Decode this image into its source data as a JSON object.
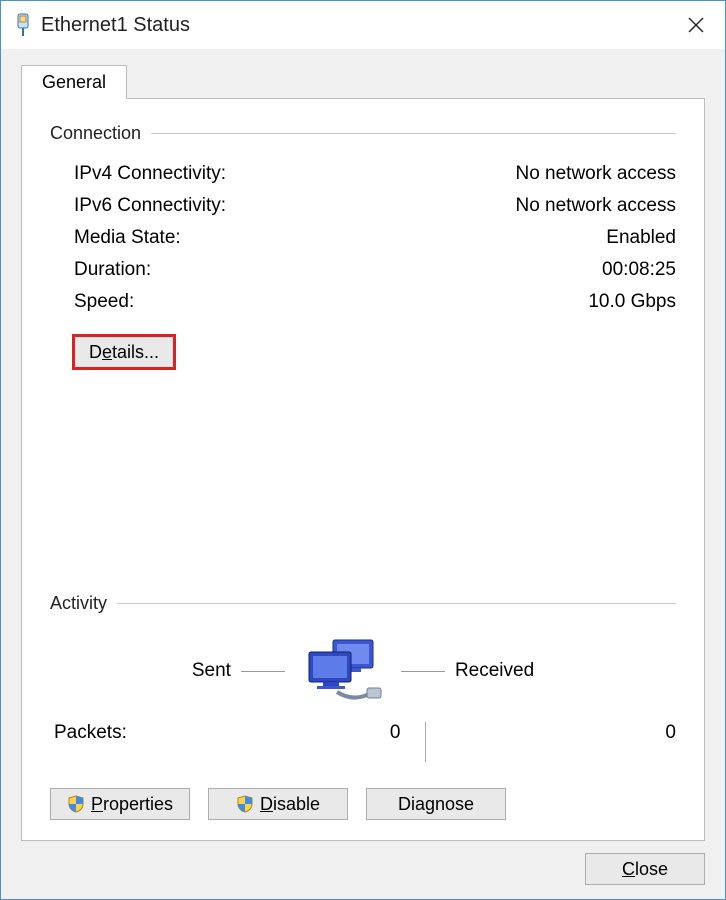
{
  "window": {
    "title": "Ethernet1 Status"
  },
  "tabs": {
    "general": "General"
  },
  "connection": {
    "heading": "Connection",
    "ipv4_label": "IPv4 Connectivity:",
    "ipv4_value": "No network access",
    "ipv6_label": "IPv6 Connectivity:",
    "ipv6_value": "No network access",
    "media_label": "Media State:",
    "media_value": "Enabled",
    "duration_label": "Duration:",
    "duration_value": "00:08:25",
    "speed_label": "Speed:",
    "speed_value": "10.0 Gbps",
    "details_prefix": "D",
    "details_accel": "e",
    "details_suffix": "tails..."
  },
  "activity": {
    "heading": "Activity",
    "sent": "Sent",
    "received": "Received",
    "packets_label": "Packets:",
    "packets_sent": "0",
    "packets_received": "0"
  },
  "buttons": {
    "properties_accel": "P",
    "properties_suffix": "roperties",
    "disable_accel": "D",
    "disable_suffix": "isable",
    "diagnose_prefix": "Dia",
    "diagnose_accel": "g",
    "diagnose_suffix": "nose",
    "close_accel": "C",
    "close_suffix": "lose"
  }
}
